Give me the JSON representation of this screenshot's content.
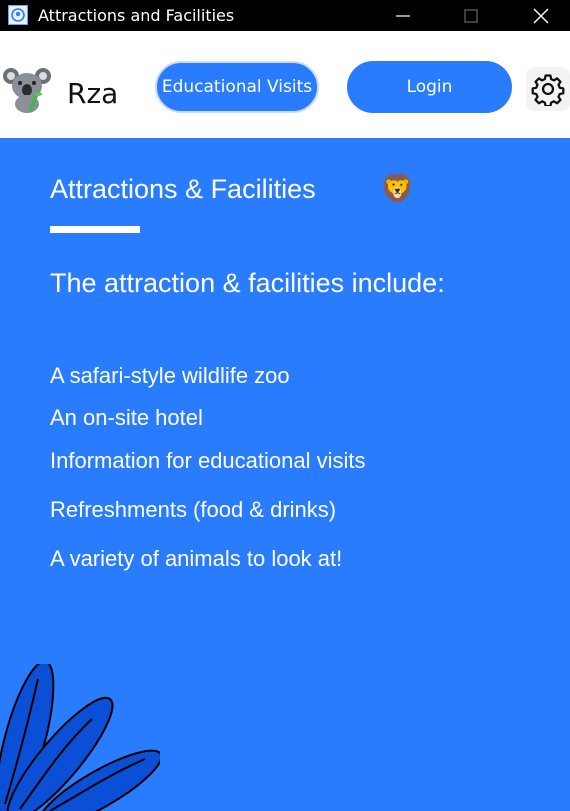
{
  "window": {
    "title": "Attractions and Facilities"
  },
  "header": {
    "brand": "Rza",
    "educational_visits_label": "Educational Visits",
    "login_label": "Login"
  },
  "main": {
    "section_title": "Attractions & Facilities",
    "emoji": "🦁",
    "subtitle": "The attraction & facilities include:",
    "items": [
      "A safari-style wildlife zoo",
      "An on-site hotel",
      "Information for educational visits",
      "Refreshments (food & drinks)",
      "A variety of animals to look at!"
    ]
  },
  "colors": {
    "accent": "#2a7cff",
    "titlebar": "#000000",
    "header_bg": "#ffffff",
    "text": "#ffffff",
    "decoration": "#0b4fd6"
  },
  "icons": {
    "app": "app-icon",
    "logo": "koala-icon",
    "settings": "gear-icon",
    "minimize": "minimize-icon",
    "maximize": "maximize-icon",
    "close": "close-icon",
    "decoration": "leaf-decoration-icon"
  }
}
